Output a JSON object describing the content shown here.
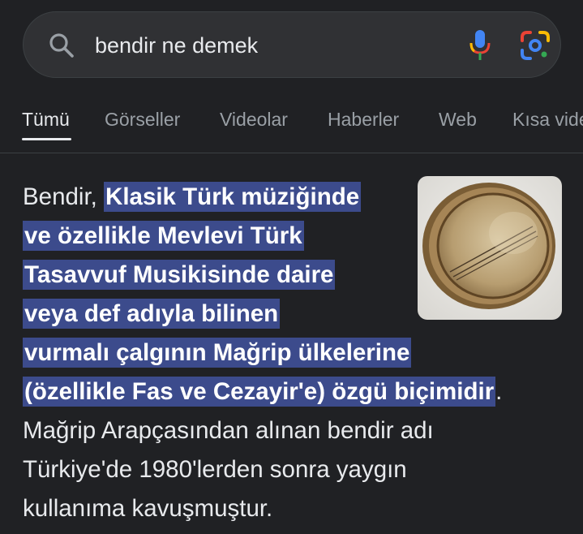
{
  "search": {
    "query": "bendir ne demek"
  },
  "tabs": [
    {
      "label": "Tümü",
      "active": true
    },
    {
      "label": "Görseller",
      "active": false
    },
    {
      "label": "Videolar",
      "active": false
    },
    {
      "label": "Haberler",
      "active": false
    },
    {
      "label": "Web",
      "active": false
    },
    {
      "label": "Kısa vide",
      "active": false
    }
  ],
  "snippet": {
    "lines": [
      {
        "plain_before": "Bendir, ",
        "highlight": "Klasik Türk müziğinde",
        "plain_after": ""
      },
      {
        "plain_before": "",
        "highlight": "ve özellikle Mevlevi Türk",
        "plain_after": ""
      },
      {
        "plain_before": "",
        "highlight": "Tasavvuf Musikisinde daire",
        "plain_after": ""
      },
      {
        "plain_before": "",
        "highlight": "veya def adıyla bilinen",
        "plain_after": ""
      },
      {
        "plain_before": "",
        "highlight": "vurmalı çalgının Mağrip ülkelerine",
        "plain_after": ""
      },
      {
        "plain_before": "",
        "highlight": "(özellikle Fas ve Cezayir'e) özgü biçimidir",
        "plain_after": "."
      },
      {
        "plain_before": "Mağrip Arapçasından alınan bendir adı",
        "highlight": "",
        "plain_after": ""
      },
      {
        "plain_before": "Türkiye'de 1980'lerden sonra yaygın",
        "highlight": "",
        "plain_after": ""
      },
      {
        "plain_before": "kullanıma kavuşmuştur.",
        "highlight": "",
        "plain_after": ""
      }
    ]
  },
  "colors": {
    "background": "#202124",
    "searchbar": "#303134",
    "highlight": "#3c4b8c",
    "text": "#e8eaed",
    "muted": "#9aa0a6"
  },
  "icons": {
    "search": "search-icon",
    "mic": "microphone-icon",
    "lens": "google-lens-icon",
    "thumbnail": "bendir-drum-image"
  }
}
